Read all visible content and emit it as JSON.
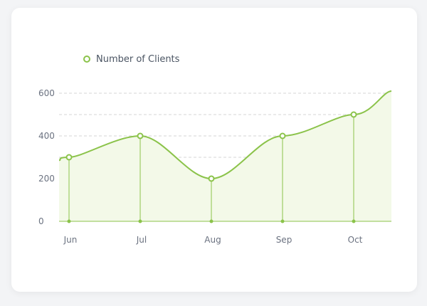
{
  "colors": {
    "series": "#8bc34a",
    "area": "#f3f9e8",
    "grid": "#d4d4d4",
    "axis": "#8bc34a",
    "tick_text": "#6b7280"
  },
  "legend": {
    "label": "Number of Clients"
  },
  "chart_data": {
    "type": "area",
    "categories": [
      "Jun",
      "Jul",
      "Aug",
      "Sep",
      "Oct"
    ],
    "series": [
      {
        "name": "Number of Clients",
        "values": [
          300,
          400,
          200,
          400,
          500
        ]
      }
    ],
    "y_ticks": [
      0,
      200,
      400,
      600
    ],
    "ylim": [
      0,
      600
    ],
    "grid": true,
    "curve": "smooth",
    "legend_position": "top-left"
  }
}
